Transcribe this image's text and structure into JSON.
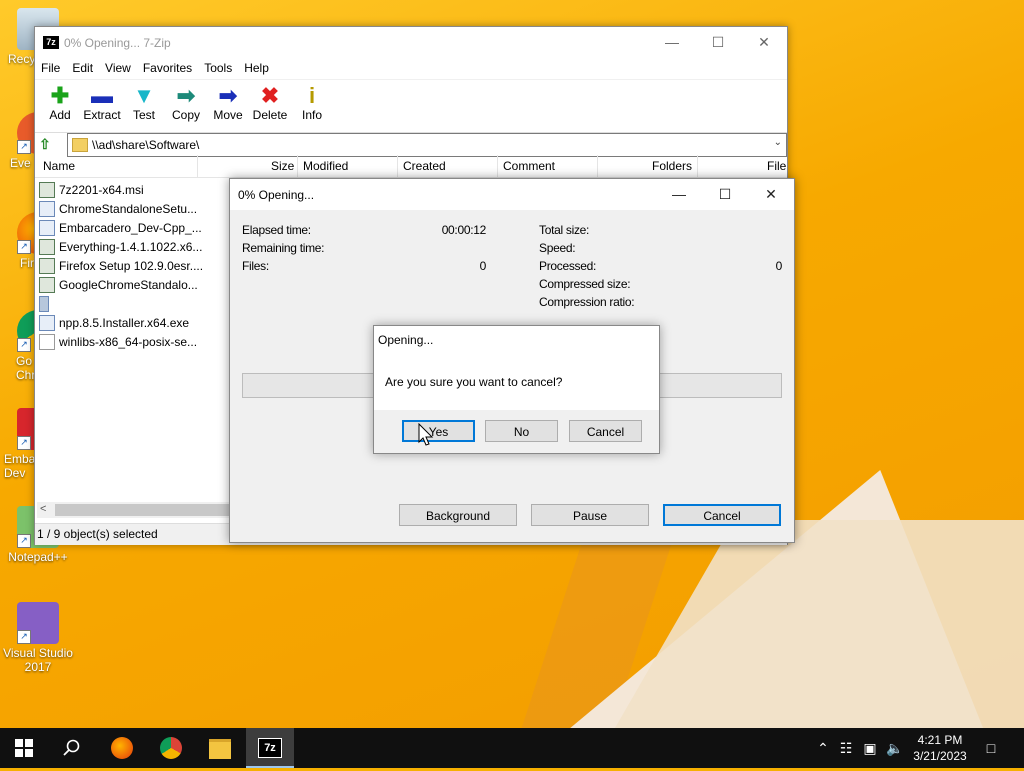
{
  "desktop": {
    "icons": [
      {
        "label": "Recy",
        "icon": "recycle-bin-icon"
      },
      {
        "label": "Eve",
        "icon": "everything-icon"
      },
      {
        "label": "Fir",
        "icon": "firefox-icon"
      },
      {
        "label": "Go Chr",
        "icon": "chrome-icon"
      },
      {
        "label": "Emba Dev",
        "icon": "embarcadero-icon"
      },
      {
        "label": "Notepad++",
        "icon": "notepadpp-icon"
      },
      {
        "label": "Visual Studio 2017",
        "icon": "visual-studio-icon"
      }
    ]
  },
  "main_window": {
    "title": "0% Opening... 7-Zip",
    "app_icon_text": "7z",
    "menu": [
      "File",
      "Edit",
      "View",
      "Favorites",
      "Tools",
      "Help"
    ],
    "toolbar": [
      {
        "label": "Add",
        "icon": "add-icon",
        "glyph": "✚",
        "color": "#1aa31a"
      },
      {
        "label": "Extract",
        "icon": "extract-icon",
        "glyph": "▬",
        "color": "#1a2fb8"
      },
      {
        "label": "Test",
        "icon": "test-icon",
        "glyph": "▼",
        "color": "#18b6c9"
      },
      {
        "label": "Copy",
        "icon": "copy-icon",
        "glyph": "➡",
        "color": "#1d8a7a"
      },
      {
        "label": "Move",
        "icon": "move-icon",
        "glyph": "➡",
        "color": "#1a2fb8"
      },
      {
        "label": "Delete",
        "icon": "delete-icon",
        "glyph": "✖",
        "color": "#e02020"
      },
      {
        "label": "Info",
        "icon": "info-icon",
        "glyph": "i",
        "color": "#b59a00"
      }
    ],
    "address": "\\\\ad\\share\\Software\\",
    "columns": [
      "Name",
      "Size",
      "Modified",
      "Created",
      "Comment",
      "Folders",
      "File"
    ],
    "files": [
      {
        "name": "7z2201-x64.msi",
        "type": "msi"
      },
      {
        "name": "ChromeStandaloneSetu...",
        "type": "exe"
      },
      {
        "name": "Embarcadero_Dev-Cpp_...",
        "type": "exe"
      },
      {
        "name": "Everything-1.4.1.1022.x6...",
        "type": "msi"
      },
      {
        "name": "Firefox Setup 102.9.0esr....",
        "type": "msi"
      },
      {
        "name": "GoogleChromeStandalo...",
        "type": "msi"
      },
      {
        "name": "",
        "type": "folder"
      },
      {
        "name": "npp.8.5.Installer.x64.exe",
        "type": "exe"
      },
      {
        "name": "winlibs-x86_64-posix-se...",
        "type": "txt"
      }
    ],
    "status": "1 / 9 object(s) selected"
  },
  "progress_dialog": {
    "title": "0% Opening...",
    "elapsed_label": "Elapsed time:",
    "elapsed_value": "00:00:12",
    "remaining_label": "Remaining time:",
    "files_label": "Files:",
    "files_value": "0",
    "total_size_label": "Total size:",
    "speed_label": "Speed:",
    "processed_label": "Processed:",
    "processed_value": "0",
    "compressed_label": "Compressed size:",
    "ratio_label": "Compression ratio:",
    "progress_fraction": 0,
    "buttons": {
      "background": "Background",
      "pause": "Pause",
      "cancel": "Cancel"
    }
  },
  "confirm_dialog": {
    "title": "Opening...",
    "message": "Are you sure you want to cancel?",
    "yes": "Yes",
    "no": "No",
    "cancel": "Cancel"
  },
  "taskbar": {
    "apps": [
      {
        "name": "start",
        "icon": "windows-start-icon"
      },
      {
        "name": "search",
        "icon": "search-icon"
      },
      {
        "name": "firefox",
        "icon": "firefox-icon"
      },
      {
        "name": "chrome",
        "icon": "chrome-icon"
      },
      {
        "name": "file-explorer",
        "icon": "folder-icon"
      },
      {
        "name": "7-zip",
        "icon": "7zip-icon",
        "label": "7z"
      }
    ],
    "time": "4:21 PM",
    "date": "3/21/2023"
  }
}
